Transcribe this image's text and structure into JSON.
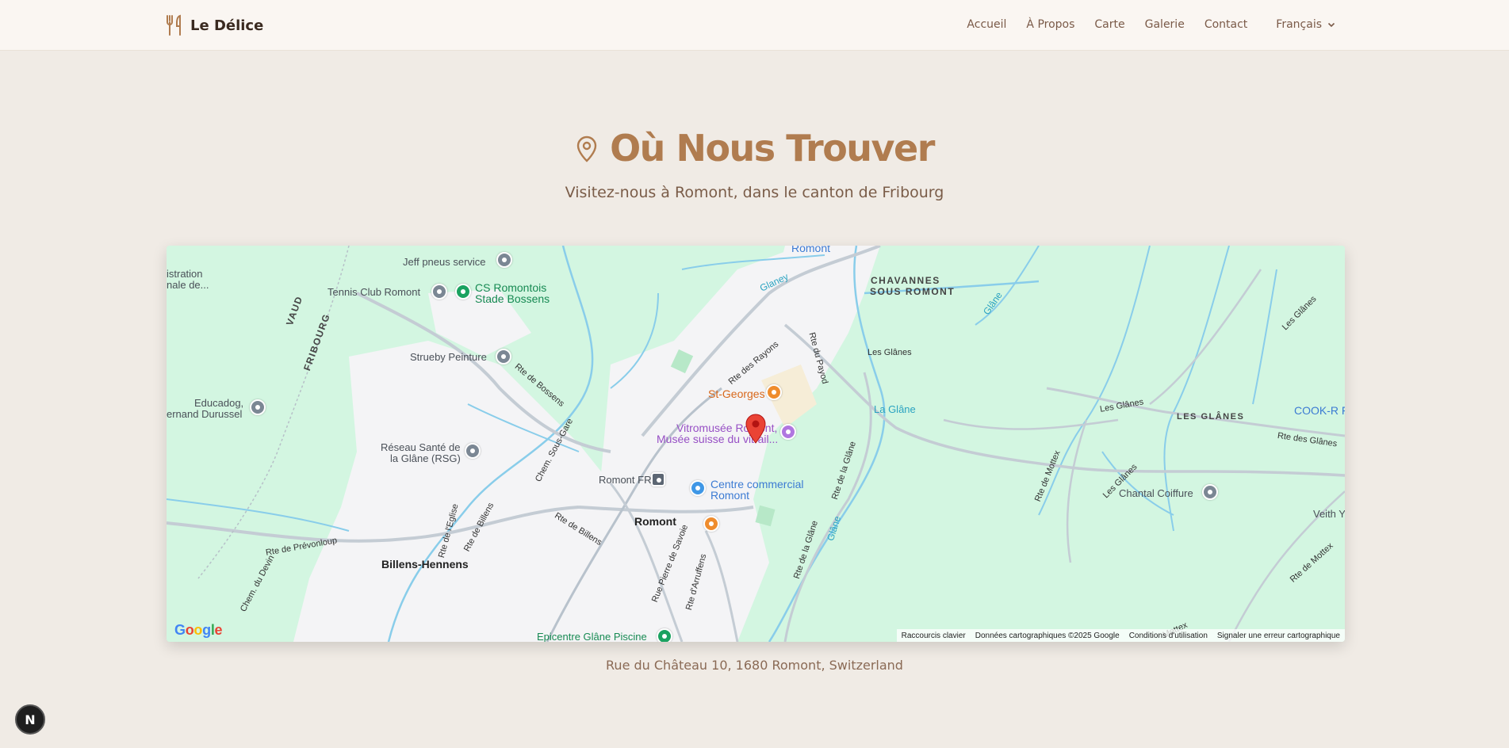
{
  "header": {
    "brand": "Le Délice",
    "nav": [
      "Accueil",
      "À Propos",
      "Carte",
      "Galerie",
      "Contact"
    ],
    "language": "Français"
  },
  "section": {
    "title": "Où Nous Trouver",
    "subtitle": "Visitez-nous à Romont, dans le canton de Fribourg",
    "address": "Rue du Château 10, 1680 Romont, Switzerland"
  },
  "map": {
    "logo": "Google",
    "attribution": [
      "Raccourcis clavier",
      "Données cartographiques ©2025 Google",
      "Conditions d'utilisation",
      "Signaler une erreur cartographique"
    ],
    "labels": {
      "romont_top": "Romont",
      "chavannes_1": "CHAVANNES",
      "chavannes_2": "SOUS ROMONT",
      "administration_1": "istration",
      "administration_2": "nale de...",
      "jeff": "Jeff pneus service",
      "tennis": "Tennis Club Romont",
      "cs_1": "CS Romontois",
      "cs_2": "Stade Bossens",
      "vaud": "VAUD",
      "fribourg": "FRIBOURG",
      "strueby": "Strueby Peinture",
      "rte_bossens": "Rte de Bossens",
      "glaney": "Glaney",
      "rte_rayons": "Rte des Rayons",
      "rte_payod": "Rte du Payod",
      "les_glanes_1": "Les Glânes",
      "glane_river": "Glâne",
      "st_georges": "St-Georges",
      "vitromusee_1": "Vitromusée Romont,",
      "vitromusee_2": "Musée suisse du vitrail...",
      "la_glane": "La Glâne",
      "educadog_1": "Educadog,",
      "educadog_2": "ernand Durussel",
      "reseau_1": "Réseau Santé de",
      "reseau_2": "la Glâne (RSG)",
      "chem_sous_gare": "Chem. Sous-Gare",
      "romont_fr": "Romont FR",
      "centre_1": "Centre commercial",
      "centre_2": "Romont",
      "romont_town": "Romont",
      "rte_eglise": "Rte de l'Eglise",
      "rte_billens_1": "Rte de Billens",
      "rte_billens_2": "Rte de Billens",
      "rte_prevonloup": "Rte de Prévonloup",
      "billens": "Billens-Hennens",
      "chem_devin": "Chem. du Devin",
      "rte_savoie": "Rue Pierre de Savoie",
      "rte_arruffens": "Rte d'Arruffens",
      "rte_glane_1": "Rte de la Glâne",
      "rte_glane_2": "Rte de la Glâne",
      "glane_2": "Glâne",
      "epicentre": "Epicentre Glâne Piscine",
      "les_glanes_2": "Les Glânes",
      "les_glanes_caps": "LES GLÂNES",
      "cook_r": "COOK-R Fo",
      "rte_glanes": "Rte des Glânes",
      "les_glanes_3": "Les Glânes",
      "les_glanes_4": "Les Glânes",
      "rte_mottex_1": "Rte de Mottex",
      "rte_mottex_2": "Rte de Mottex",
      "mottex": "Mottex",
      "chantal": "Chantal Coiffure",
      "veith": "Veith Yo"
    }
  },
  "devtools_badge": "N",
  "colors": {
    "accent": "#b07c4f",
    "background": "#f0ebe5",
    "nav_bg": "#faf6f2",
    "map_green": "#d3f6e1",
    "marker_red": "#ea4335"
  }
}
